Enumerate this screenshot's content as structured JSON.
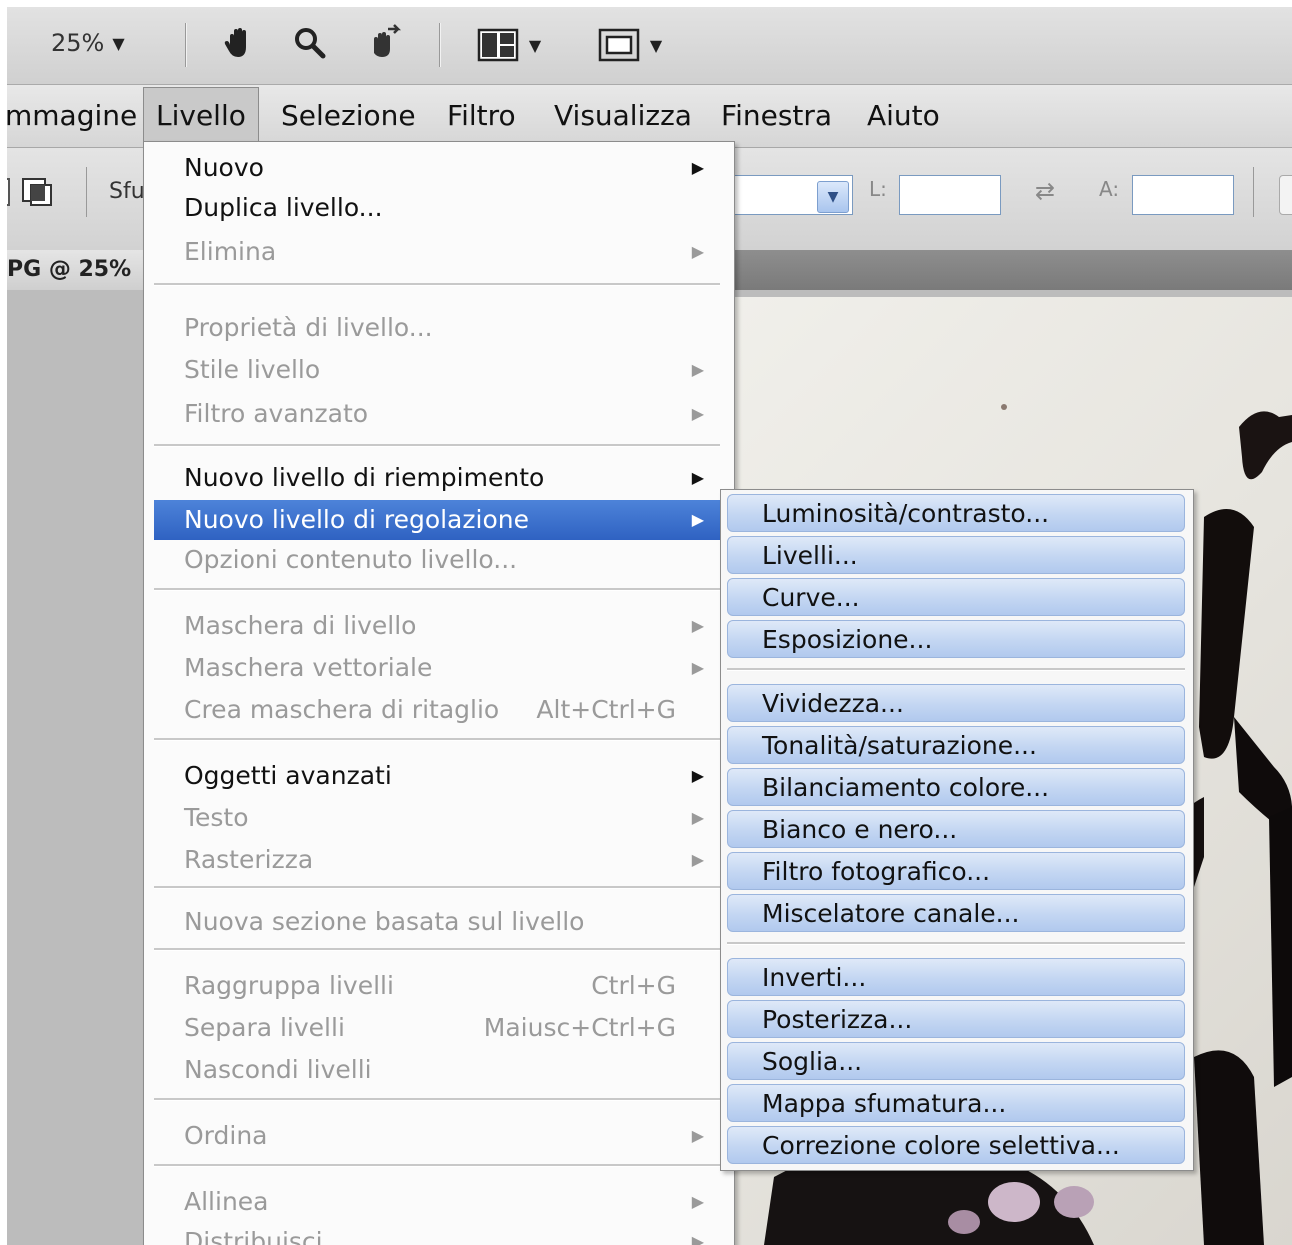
{
  "toolbar": {
    "zoom_value": "25%",
    "icons": [
      "hand-icon",
      "zoom-icon",
      "rotate-view-icon",
      "arrange-documents-icon",
      "screen-mode-icon"
    ]
  },
  "menubar": {
    "items": [
      "mmagine",
      "Livello",
      "Selezione",
      "Filtro",
      "Visualizza",
      "Finestra",
      "Aiuto"
    ],
    "active": "Livello"
  },
  "options": {
    "partial_label": "Sfu",
    "width_label": "L:",
    "height_label": "A:"
  },
  "document": {
    "tab_title": "PG @ 25%"
  },
  "livello_menu": {
    "items": [
      {
        "label": "Nuovo",
        "enabled": true,
        "submenu": true
      },
      {
        "label": "Duplica livello...",
        "enabled": true
      },
      {
        "label": "Elimina",
        "enabled": false,
        "submenu": true
      },
      {
        "label": "Proprietà di livello...",
        "enabled": false
      },
      {
        "label": "Stile livello",
        "enabled": false,
        "submenu": true
      },
      {
        "label": "Filtro avanzato",
        "enabled": false,
        "submenu": true
      },
      {
        "label": "Nuovo livello di riempimento",
        "enabled": true,
        "submenu": true
      },
      {
        "label": "Nuovo livello di regolazione",
        "enabled": true,
        "submenu": true,
        "highlighted": true
      },
      {
        "label": "Opzioni contenuto livello...",
        "enabled": false
      },
      {
        "label": "Maschera di livello",
        "enabled": false,
        "submenu": true
      },
      {
        "label": "Maschera vettoriale",
        "enabled": false,
        "submenu": true
      },
      {
        "label": "Crea maschera di ritaglio",
        "enabled": false,
        "shortcut": "Alt+Ctrl+G"
      },
      {
        "label": "Oggetti avanzati",
        "enabled": true,
        "submenu": true
      },
      {
        "label": "Testo",
        "enabled": false,
        "submenu": true
      },
      {
        "label": "Rasterizza",
        "enabled": false,
        "submenu": true
      },
      {
        "label": "Nuova sezione basata sul livello",
        "enabled": false
      },
      {
        "label": "Raggruppa livelli",
        "enabled": false,
        "shortcut": "Ctrl+G"
      },
      {
        "label": "Separa livelli",
        "enabled": false,
        "shortcut": "Maiusc+Ctrl+G"
      },
      {
        "label": "Nascondi livelli",
        "enabled": false
      },
      {
        "label": "Ordina",
        "enabled": false,
        "submenu": true
      },
      {
        "label": "Allinea",
        "enabled": false,
        "submenu": true
      },
      {
        "label": "Distribuisci",
        "enabled": false,
        "submenu": true
      }
    ]
  },
  "regolazione_submenu": {
    "items": [
      "Luminosità/contrasto...",
      "Livelli...",
      "Curve...",
      "Esposizione...",
      "Vividezza...",
      "Tonalità/saturazione...",
      "Bilanciamento colore...",
      "Bianco e nero...",
      "Filtro fotografico...",
      "Miscelatore canale...",
      "Inverti...",
      "Posterizza...",
      "Soglia...",
      "Mappa sfumatura...",
      "Correzione colore selettiva..."
    ]
  },
  "colors": {
    "highlight": "#3b6fcc",
    "submenu_item": "#c3d6f2",
    "disabled_text": "#9a9a9a"
  }
}
